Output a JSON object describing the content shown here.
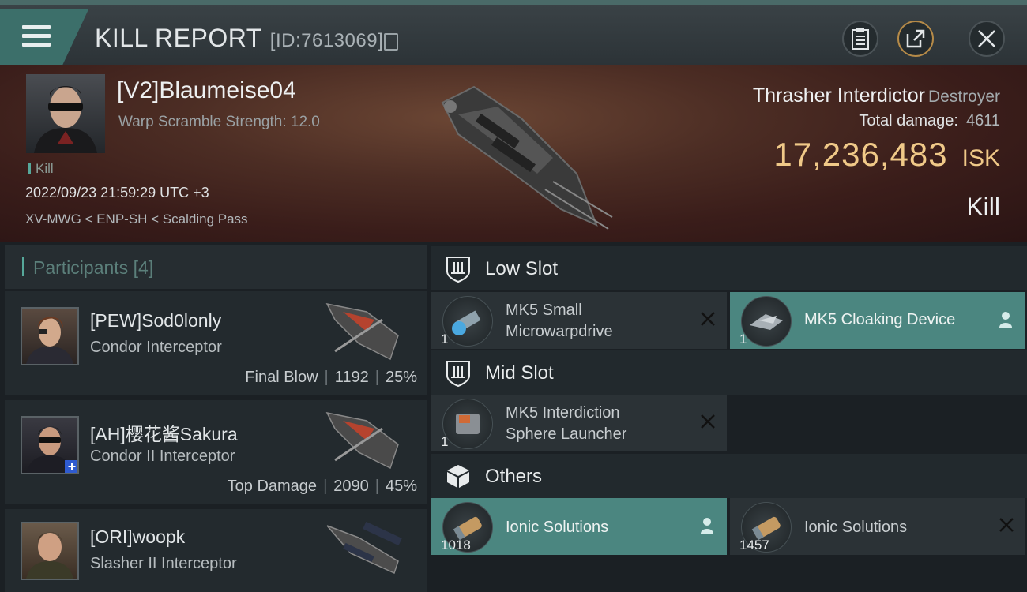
{
  "header": {
    "title": "KILL REPORT",
    "report_id": "[ID:7613069]"
  },
  "victim": {
    "name": "[V2]Blaumeise04",
    "scramble": "Warp Scramble Strength: 12.0",
    "tag": "Kill",
    "datetime": "2022/09/23 21:59:29 UTC +3",
    "location": "XV-MWG < ENP-SH < Scalding Pass",
    "ship_name": "Thrasher Interdictor",
    "ship_class": "Destroyer",
    "damage_label": "Total damage:",
    "damage_value": "4611",
    "isk_value": "17,236,483",
    "isk_unit": "ISK",
    "result": "Kill"
  },
  "participants": {
    "label": "Participants",
    "count": "[4]",
    "items": [
      {
        "name": "[PEW]Sod0lonly",
        "ship": "Condor Interceptor",
        "role": "Final Blow",
        "damage": "1192",
        "percent": "25%"
      },
      {
        "name": "[AH]樱花酱Sakura",
        "ship": "Condor II Interceptor",
        "role": "Top Damage",
        "damage": "2090",
        "percent": "45%"
      },
      {
        "name": "[ORI]woopk",
        "ship": "Slasher II Interceptor",
        "role": "",
        "damage": "",
        "percent": ""
      }
    ]
  },
  "slots": {
    "low": {
      "label": "Low Slot",
      "modules": [
        {
          "name_line1": "MK5 Small",
          "name_line2": "Microwarpdrive",
          "qty": "1",
          "state": "destroyed"
        },
        {
          "name_line1": "MK5 Cloaking Device",
          "name_line2": "",
          "qty": "1",
          "state": "dropped"
        }
      ]
    },
    "mid": {
      "label": "Mid Slot",
      "modules": [
        {
          "name_line1": "MK5 Interdiction",
          "name_line2": "Sphere Launcher",
          "qty": "1",
          "state": "destroyed"
        }
      ]
    },
    "others": {
      "label": "Others",
      "modules": [
        {
          "name_line1": "Ionic Solutions",
          "name_line2": "",
          "qty": "1018",
          "state": "dropped"
        },
        {
          "name_line1": "Ionic Solutions",
          "name_line2": "",
          "qty": "1457",
          "state": "destroyed"
        }
      ]
    }
  },
  "colors": {
    "accent": "#56a89a",
    "highlight": "#4b8680",
    "isk": "#f0c988"
  },
  "icons": [
    "menu-icon",
    "copy-icon",
    "clipboard-icon",
    "share-icon",
    "close-icon",
    "shield-icon",
    "box-icon",
    "person-icon",
    "x-icon"
  ]
}
